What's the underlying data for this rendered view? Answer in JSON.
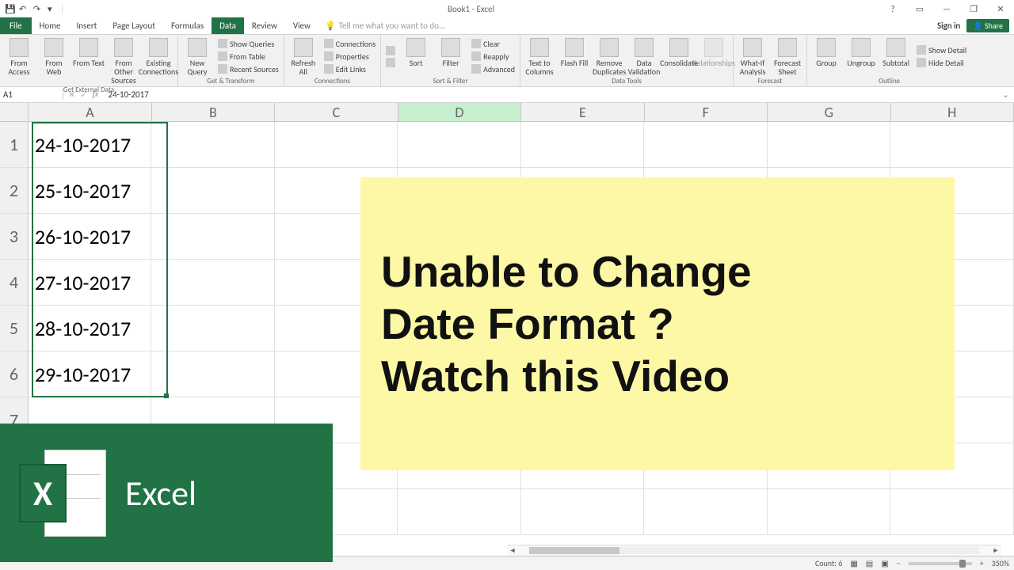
{
  "titlebar": {
    "title": "Book1 - Excel"
  },
  "window_controls": {
    "help": "?",
    "ribbon_opts": "▭",
    "min": "—",
    "max": "❐",
    "close": "✕"
  },
  "menu": {
    "file": "File",
    "tabs": [
      "Home",
      "Insert",
      "Page Layout",
      "Formulas",
      "Data",
      "Review",
      "View"
    ],
    "active_index": 4,
    "tellme": "Tell me what you want to do...",
    "signin": "Sign in",
    "share": "Share"
  },
  "ribbon": {
    "get_external_data": {
      "from_access": "From Access",
      "from_web": "From Web",
      "from_text": "From Text",
      "from_other": "From Other Sources",
      "existing": "Existing Connections",
      "label": "Get External Data"
    },
    "get_transform": {
      "new_query": "New Query",
      "show_queries": "Show Queries",
      "from_table": "From Table",
      "recent_sources": "Recent Sources",
      "label": "Get & Transform"
    },
    "connections": {
      "refresh_all": "Refresh All",
      "connections": "Connections",
      "properties": "Properties",
      "edit_links": "Edit Links",
      "label": "Connections"
    },
    "sort_filter": {
      "sort_az": "A→Z",
      "sort_za": "Z→A",
      "sort": "Sort",
      "filter": "Filter",
      "clear": "Clear",
      "reapply": "Reapply",
      "advanced": "Advanced",
      "label": "Sort & Filter"
    },
    "data_tools": {
      "text_to_columns": "Text to Columns",
      "flash_fill": "Flash Fill",
      "remove_dups": "Remove Duplicates",
      "data_validation": "Data Validation",
      "consolidate": "Consolidate",
      "relationships": "Relationships",
      "label": "Data Tools"
    },
    "forecast": {
      "whatif": "What-If Analysis",
      "forecast_sheet": "Forecast Sheet",
      "label": "Forecast"
    },
    "outline": {
      "group": "Group",
      "ungroup": "Ungroup",
      "subtotal": "Subtotal",
      "show_detail": "Show Detail",
      "hide_detail": "Hide Detail",
      "label": "Outline"
    }
  },
  "formula_bar": {
    "name_box": "A1",
    "value": "24-10-2017"
  },
  "grid": {
    "columns": [
      "A",
      "B",
      "C",
      "D",
      "E",
      "F",
      "G",
      "H"
    ],
    "highlight_col": "D",
    "row_numbers": [
      "1",
      "2",
      "3",
      "4",
      "5",
      "6",
      "7"
    ],
    "values_A": [
      "24-10-2017",
      "25-10-2017",
      "26-10-2017",
      "27-10-2017",
      "28-10-2017",
      "29-10-2017",
      ""
    ]
  },
  "status": {
    "count_label": "Count: 6",
    "zoom": "350%"
  },
  "callout": {
    "line1": "Unable to Change",
    "line2": "Date Format ?",
    "line3": "Watch this Video"
  },
  "logo": {
    "x": "X",
    "name": "Excel"
  }
}
